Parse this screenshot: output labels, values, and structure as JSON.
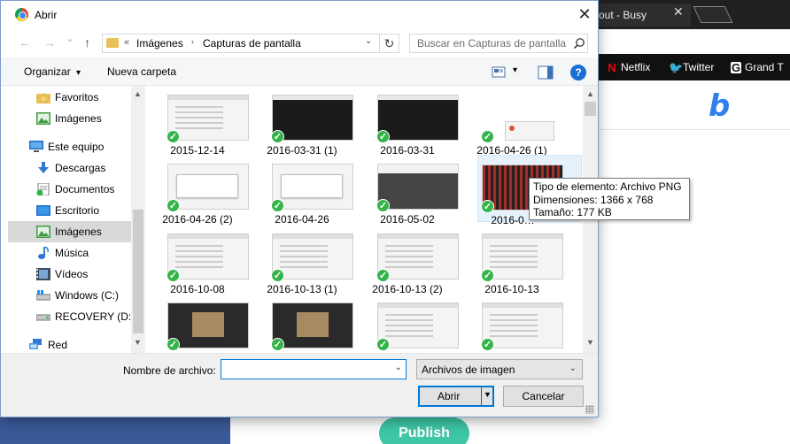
{
  "browser": {
    "tab_title": "out - Busy",
    "tab_close": "✕",
    "bookmarks": [
      {
        "label": "Netflix",
        "icon": "netflix-icon",
        "glyph": "N",
        "color": "#e50914"
      },
      {
        "label": "Twitter",
        "icon": "twitter-icon",
        "glyph": "🐦",
        "color": "#1da1f2"
      },
      {
        "label": "Grand T",
        "icon": "grand-t-icon",
        "glyph": "G",
        "color": "#ffffff"
      }
    ],
    "brand_letter": "b",
    "publish_label": "Publish"
  },
  "dialog": {
    "title": "Abrir",
    "close_glyph": "✕",
    "nav": {
      "back_glyph": "←",
      "forward_glyph": "→",
      "recent_glyph": "⌄",
      "up_glyph": "↑"
    },
    "address": {
      "prefix": "«",
      "crumbs": [
        "Imágenes",
        "Capturas de pantalla"
      ],
      "chevron": "›",
      "dropdown_glyph": "⌄",
      "refresh_glyph": "↻"
    },
    "search": {
      "placeholder": "Buscar en Capturas de pantalla"
    },
    "toolbar": {
      "organize_label": "Organizar",
      "organize_caret": "▾",
      "new_folder_label": "Nueva carpeta",
      "view_caret": "▾",
      "help_glyph": "?"
    },
    "nav_pane": {
      "items": [
        {
          "label": "Favoritos",
          "icon": "star-folder-icon",
          "selected": false
        },
        {
          "label": "Imágenes",
          "icon": "pictures-icon",
          "selected": false
        },
        {
          "label": "Este equipo",
          "icon": "computer-icon",
          "selected": false
        },
        {
          "label": "Descargas",
          "icon": "download-icon",
          "selected": false
        },
        {
          "label": "Documentos",
          "icon": "documents-icon",
          "selected": false
        },
        {
          "label": "Escritorio",
          "icon": "desktop-icon",
          "selected": false
        },
        {
          "label": "Imágenes",
          "icon": "pictures-icon",
          "selected": true
        },
        {
          "label": "Música",
          "icon": "music-icon",
          "selected": false
        },
        {
          "label": "Vídeos",
          "icon": "videos-icon",
          "selected": false
        },
        {
          "label": "Windows (C:)",
          "icon": "drive-c-icon",
          "selected": false
        },
        {
          "label": "RECOVERY (D:)",
          "icon": "drive-d-icon",
          "selected": false
        },
        {
          "label": "Red",
          "icon": "network-icon",
          "selected": false
        }
      ],
      "scroll_up": "▲",
      "scroll_down": "▼"
    },
    "files": [
      {
        "name": "2015-12-14",
        "thumb": "light"
      },
      {
        "name": "2016-03-31 (1)",
        "thumb": "dark"
      },
      {
        "name": "2016-03-31",
        "thumb": "dark"
      },
      {
        "name": "2016-04-26 (1)",
        "thumb": "small"
      },
      {
        "name": "2016-04-26 (2)",
        "thumb": "dialog"
      },
      {
        "name": "2016-04-26",
        "thumb": "dialog"
      },
      {
        "name": "2016-05-02",
        "thumb": "mixed"
      },
      {
        "name": "2016-0…",
        "thumb": "redgrid"
      },
      {
        "name": "2016-10-08",
        "thumb": "light"
      },
      {
        "name": "2016-10-13 (1)",
        "thumb": "light"
      },
      {
        "name": "2016-10-13 (2)",
        "thumb": "light"
      },
      {
        "name": "2016-10-13",
        "thumb": "light"
      },
      {
        "name": "",
        "thumb": "video"
      },
      {
        "name": "",
        "thumb": "video"
      },
      {
        "name": "",
        "thumb": "light"
      },
      {
        "name": "",
        "thumb": "light"
      }
    ],
    "check_glyph": "✓",
    "grid_scroll_up": "▲",
    "grid_scroll_down": "▼",
    "tooltip": {
      "line1": "Tipo de elemento: Archivo PNG",
      "line2": "Dimensiones: 1366 x 768",
      "line3": "Tamaño: 177 KB"
    },
    "bottom": {
      "filename_label": "Nombre de archivo:",
      "filename_value": "",
      "filename_dropdown": "⌄",
      "filetype_value": "Archivos de imagen",
      "filetype_dropdown": "⌄",
      "open_label": "Abrir",
      "open_dropdown": "▼",
      "cancel_label": "Cancelar"
    }
  }
}
